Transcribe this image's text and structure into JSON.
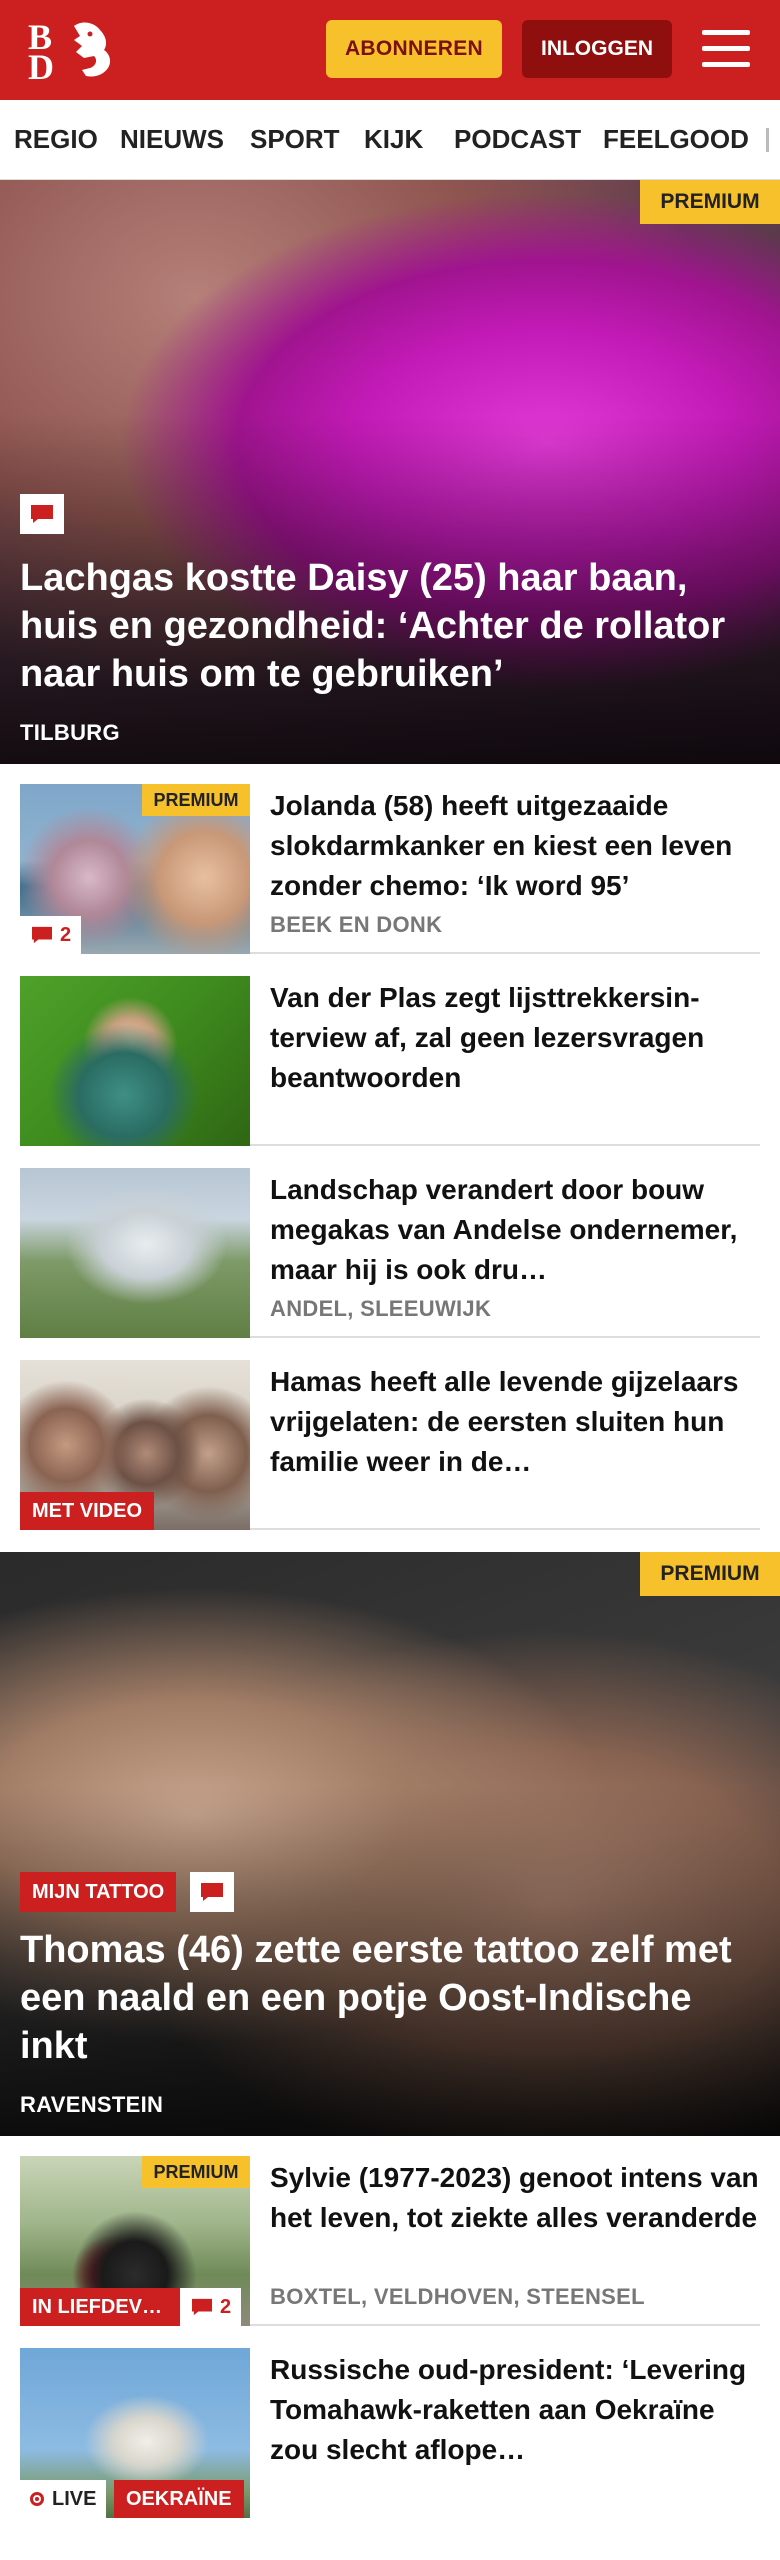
{
  "header": {
    "logo_letters": [
      "B",
      "D"
    ],
    "subscribe_label": "ABONNEREN",
    "login_label": "INLOGGEN"
  },
  "nav": {
    "items": [
      "REGIO",
      "NIEUWS",
      "SPORT",
      "KIJK",
      "PODCAST",
      "FEELGOOD"
    ]
  },
  "hero1": {
    "badge": "PREMIUM",
    "title": "Lachgas kostte Daisy (25) haar baan, huis en gezondheid: ‘Achter de rollator naar huis om te gebruiken’",
    "location": "TILBURG"
  },
  "list1": [
    {
      "title": "Jolanda (58) heeft uitgezaaide slokdarmkanker en kiest een leven zonder chemo: ‘Ik word 95’",
      "location": "BEEK EN DONK",
      "badge": "PREMIUM",
      "comments": "2"
    },
    {
      "title": "Van der Plas zegt lijsttrekkersin­terview af, zal geen lezersvragen beantwoorden"
    },
    {
      "title": "Landschap verandert door bouw megakas van Andelse ondernemer, maar hij is ook dru…",
      "location": "ANDEL, SLEEUWIJK"
    },
    {
      "title": "Hamas heeft alle levende gijzelaars vrijgelaten: de eersten sluiten hun familie weer in de…",
      "tag": "MET VIDEO"
    }
  ],
  "hero2": {
    "badge": "PREMIUM",
    "tag": "MIJN TATTOO",
    "title": "Thomas (46) zette eerste tattoo zelf met een naald en een potje Oost-Indische inkt",
    "location": "RAVENSTEIN"
  },
  "list2": [
    {
      "title": "Sylvie (1977-2023) genoot intens van het leven, tot ziekte alles veranderde",
      "location": "BOXTEL, VELDHOVEN, STEENSEL",
      "badge": "PREMIUM",
      "tag": "IN LIEFDEV…",
      "comments": "2"
    },
    {
      "title": "Russische oud-president: ‘Levering Tomahawk-raketten aan Oekraïne zou slecht aflope…",
      "live": "LIVE",
      "tag": "OEKRAÏNE"
    }
  ],
  "colors": {
    "brand_red": "#cc1f1f",
    "dark_red": "#8f0f0f",
    "premium_yellow": "#f6c12b"
  }
}
